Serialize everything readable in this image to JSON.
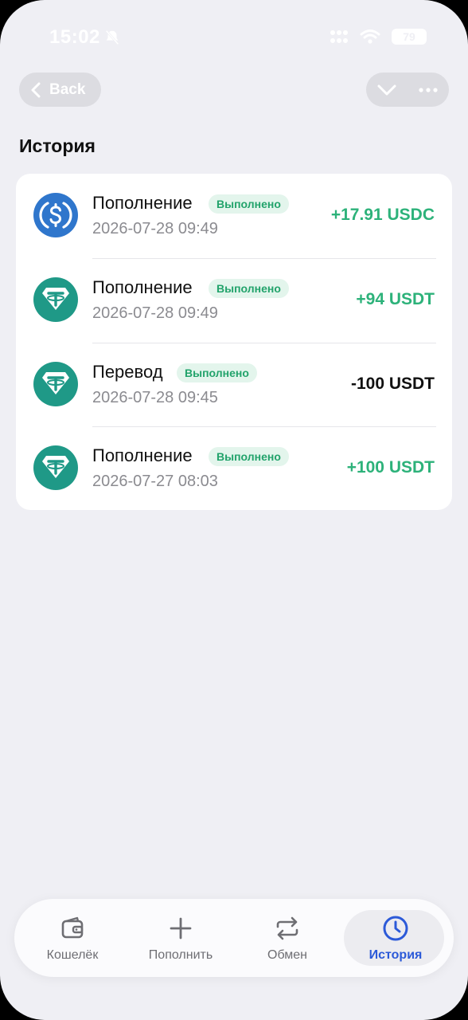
{
  "status_bar": {
    "time": "15:02",
    "battery": "79"
  },
  "header": {
    "back_label": "Back",
    "title": "История"
  },
  "transactions": [
    {
      "type": "Пополнение",
      "status": "Выполнено",
      "date": "2026-07-28 09:49",
      "amount": "+17.91 USDC",
      "coin_icon": "usdc-icon"
    },
    {
      "type": "Пополнение",
      "status": "Выполнено",
      "date": "2026-07-28 09:49",
      "amount": "+94 USDT",
      "coin_icon": "usdt-icon"
    },
    {
      "type": "Перевод",
      "status": "Выполнено",
      "date": "2026-07-28 09:45",
      "amount": "-100 USDT",
      "coin_icon": "usdt-icon"
    },
    {
      "type": "Пополнение",
      "status": "Выполнено",
      "date": "2026-07-27 08:03",
      "amount": "+100 USDT",
      "coin_icon": "usdt-icon"
    }
  ],
  "nav": {
    "items": [
      {
        "label": "Кошелёк",
        "icon": "wallet-icon"
      },
      {
        "label": "Пополнить",
        "icon": "plus-icon"
      },
      {
        "label": "Обмен",
        "icon": "exchange-icon"
      },
      {
        "label": "История",
        "icon": "clock-icon",
        "active": true
      }
    ]
  },
  "colors": {
    "positive": "#2db27a",
    "accent": "#2c5ad8",
    "usdc": "#2f76cc",
    "usdt": "#1f9987"
  }
}
